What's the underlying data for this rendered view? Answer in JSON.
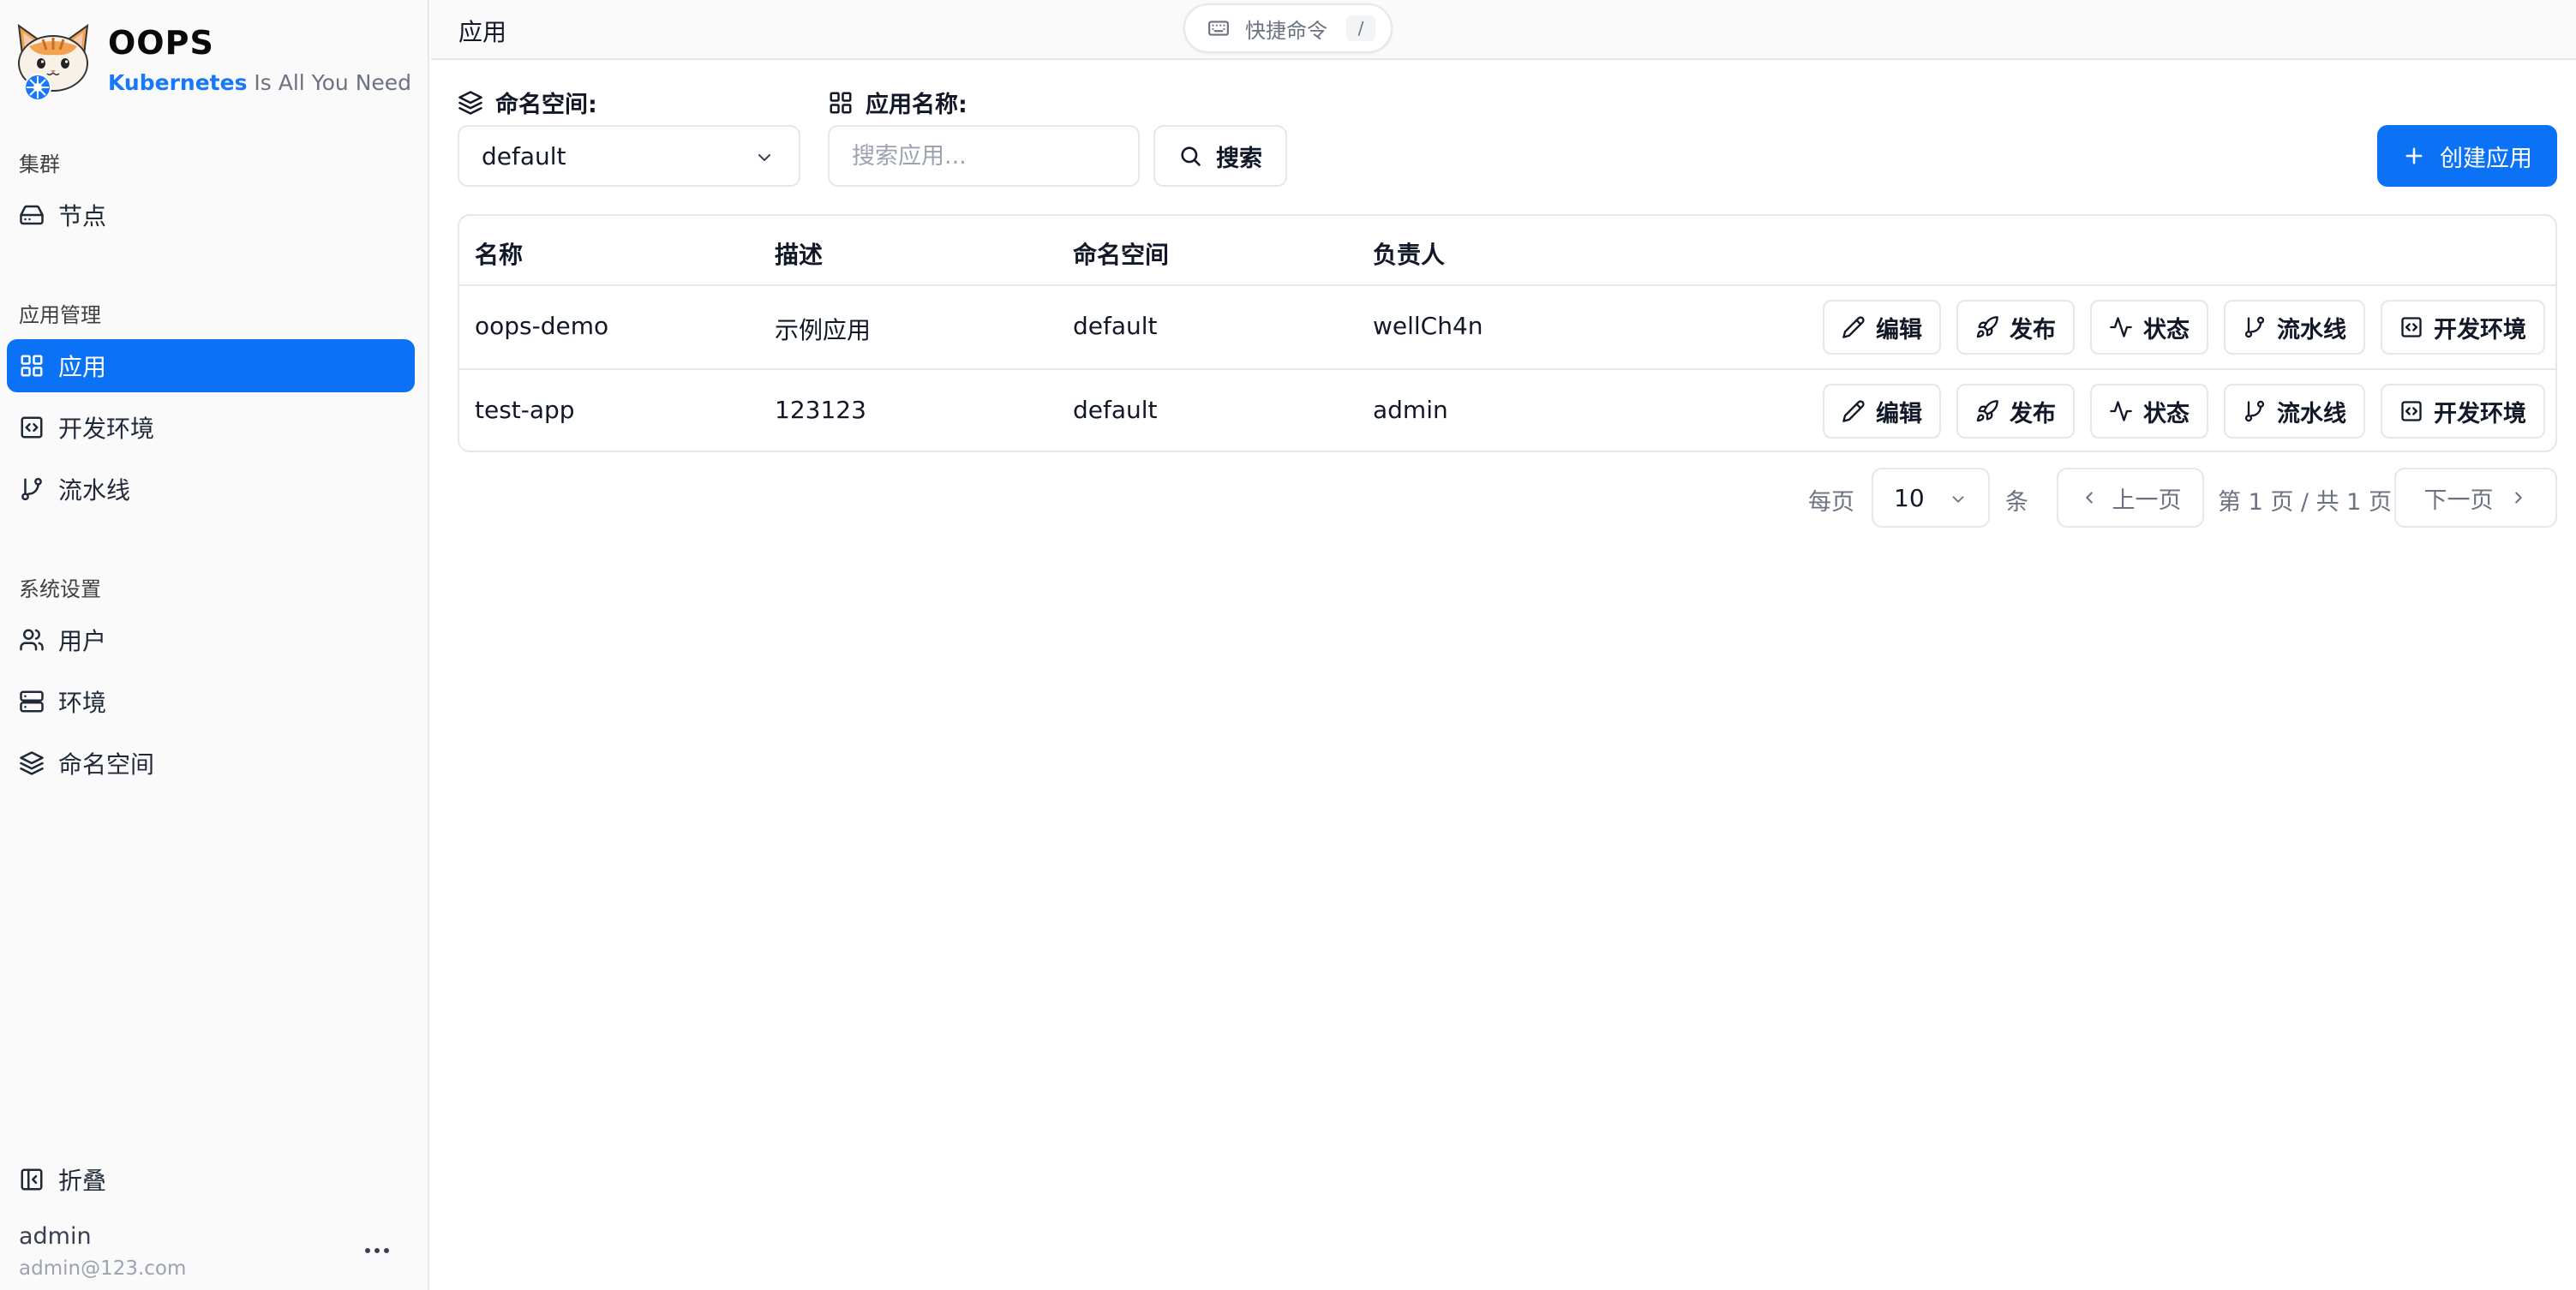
{
  "app": {
    "name": "OOPS",
    "tagline_brand": "Kubernetes",
    "tagline_rest": " Is All You Need"
  },
  "sidebar": {
    "groups": [
      {
        "label": "集群",
        "items": [
          {
            "label": "节点",
            "icon": "hard-drive-icon"
          }
        ]
      },
      {
        "label": "应用管理",
        "items": [
          {
            "label": "应用",
            "icon": "grid-icon",
            "active": true
          },
          {
            "label": "开发环境",
            "icon": "code-square-icon"
          },
          {
            "label": "流水线",
            "icon": "git-branch-icon"
          }
        ]
      },
      {
        "label": "系统设置",
        "items": [
          {
            "label": "用户",
            "icon": "users-icon"
          },
          {
            "label": "环境",
            "icon": "server-icon"
          },
          {
            "label": "命名空间",
            "icon": "layers-icon"
          }
        ]
      }
    ],
    "collapse_label": "折叠",
    "user": {
      "name": "admin",
      "email": "admin@123.com"
    }
  },
  "topbar": {
    "title": "应用",
    "command_label": "快捷命令",
    "command_key": "/"
  },
  "filters": {
    "namespace_label": "命名空间:",
    "namespace_value": "default",
    "app_name_label": "应用名称:",
    "search_placeholder": "搜索应用...",
    "search_button": "搜索",
    "create_button": "创建应用"
  },
  "table": {
    "columns": [
      "名称",
      "描述",
      "命名空间",
      "负责人"
    ],
    "rows": [
      {
        "name": "oops-demo",
        "description": "示例应用",
        "namespace": "default",
        "owner": "wellCh4n"
      },
      {
        "name": "test-app",
        "description": "123123",
        "namespace": "default",
        "owner": "admin"
      }
    ],
    "actions": [
      "编辑",
      "发布",
      "状态",
      "流水线",
      "开发环境"
    ]
  },
  "pagination": {
    "per_page_label": "每页",
    "page_size": "10",
    "unit_label": "条",
    "prev_label": "上一页",
    "page_info": "第 1 页 / 共 1 页",
    "next_label": "下一页"
  },
  "colors": {
    "accent": "#0b72f5",
    "border": "#e5e7eb",
    "muted_text": "#6b7280",
    "sidebar_bg": "#fafafa"
  }
}
